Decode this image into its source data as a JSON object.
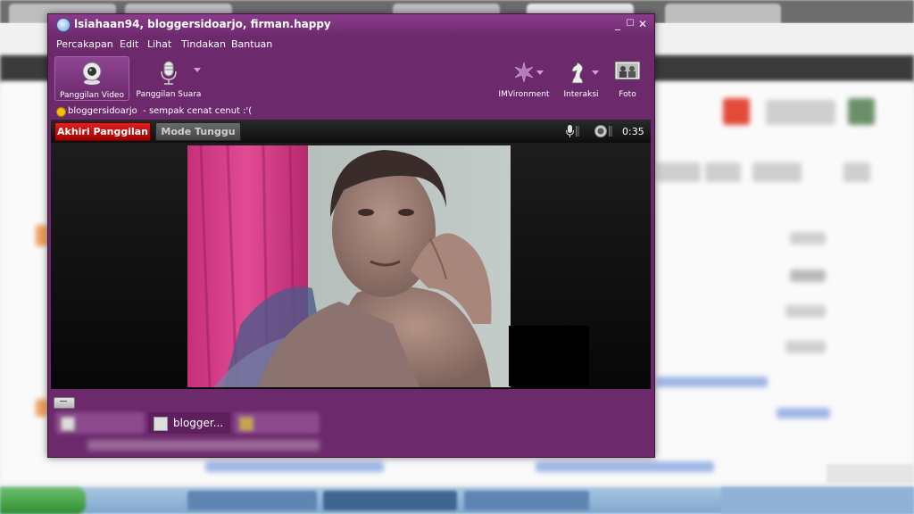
{
  "window": {
    "title": "lsiahaan94, bloggersidoarjo, firman.happy",
    "controls": {
      "minimize": "_",
      "maximize": "☐",
      "close": "✕"
    }
  },
  "menu": [
    "Percakapan",
    "Edit",
    "Lihat",
    "Tindakan",
    "Bantuan"
  ],
  "toolbar": {
    "video_call": "Panggilan Video",
    "voice_call": "Panggilan Suara",
    "imvironment": "IMVironment",
    "interaction": "Interaksi",
    "photo": "Foto"
  },
  "status": {
    "contact": "bloggersidoarjo",
    "message": "- sempak cenat cenut :'("
  },
  "call": {
    "end_button": "Akhiri Panggilan",
    "hold_button": "Mode Tunggu",
    "timer": "0:35"
  },
  "tabs": {
    "active_label": "blogger..."
  },
  "colors": {
    "window": "#6c2a6c",
    "end_call": "#c81010"
  }
}
